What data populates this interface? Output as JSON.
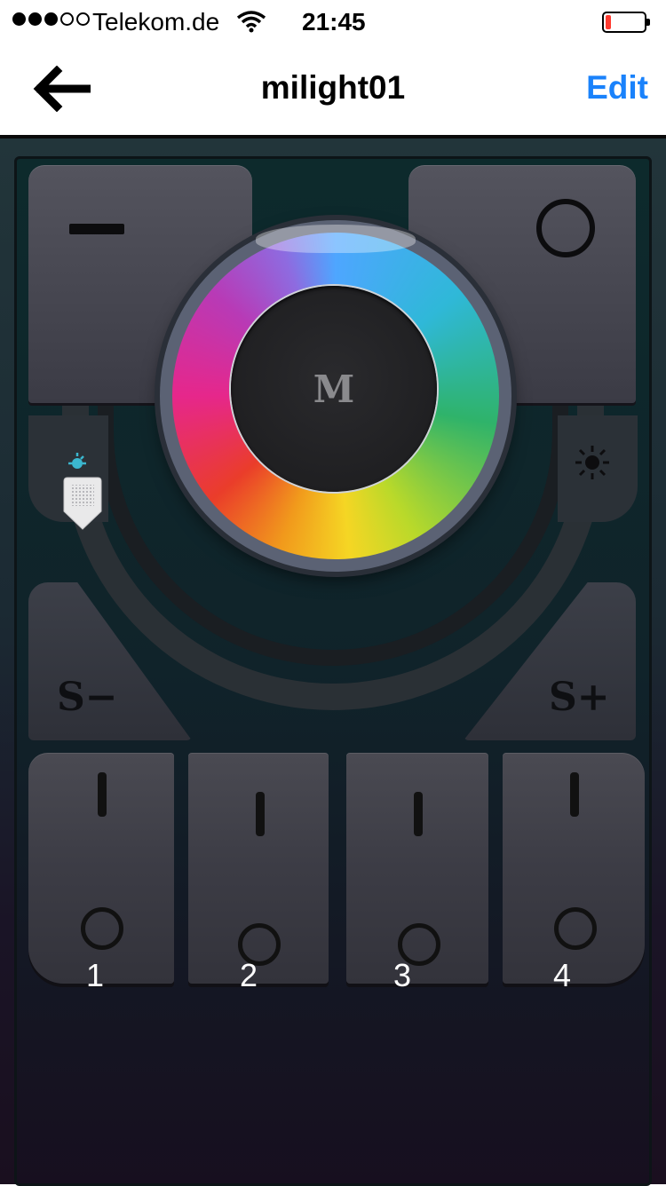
{
  "status_bar": {
    "signal_dots_filled": 3,
    "signal_dots_total": 5,
    "carrier": "Telekom.de",
    "time": "21:45",
    "battery_level_fraction": 0.15,
    "battery_color": "#ff3b30"
  },
  "nav": {
    "back_icon": "arrow-left-icon",
    "title": "milight01",
    "edit_label": "Edit",
    "edit_color": "#1a82fb"
  },
  "remote": {
    "top_left_icon": "minus-icon",
    "top_right_icon": "power-ring-icon",
    "color_wheel_center_label": "M",
    "brightness_low_icon": "brightness-low-icon",
    "brightness_high_icon": "brightness-high-icon",
    "brightness_slider_level_fraction": 0.0,
    "speed_minus_label": "S−",
    "speed_plus_label": "S+",
    "zones": [
      {
        "number": "1"
      },
      {
        "number": "2"
      },
      {
        "number": "3"
      },
      {
        "number": "4"
      }
    ]
  }
}
